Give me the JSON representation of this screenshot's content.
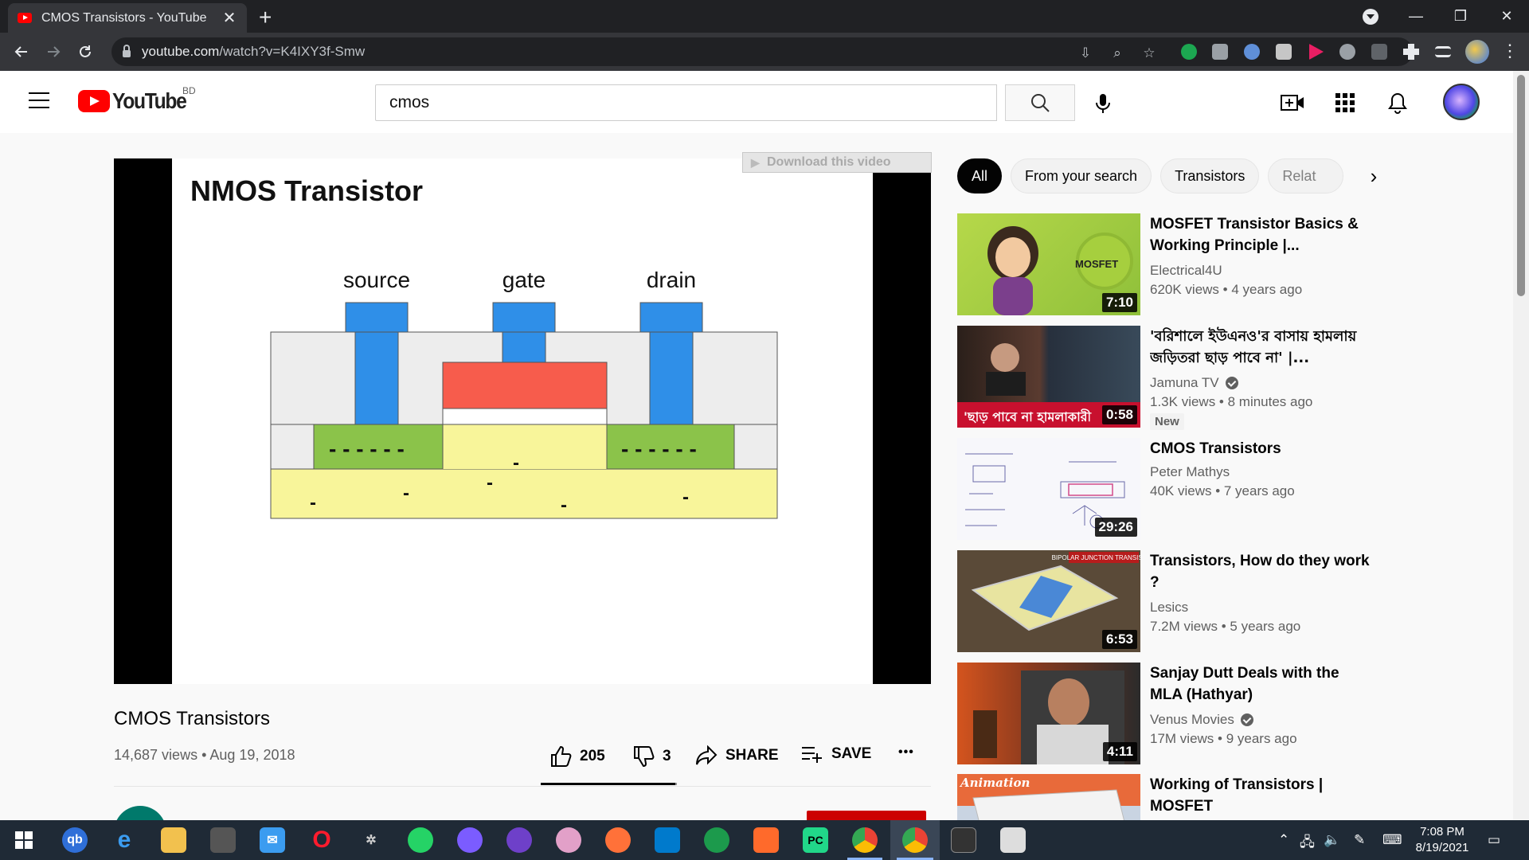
{
  "browser": {
    "tab_title": "CMOS Transistors - YouTube",
    "tab_close": "✕",
    "new_tab": "+",
    "url_host": "youtube.com",
    "url_path": "/watch?v=K4IXY3f-Smw",
    "window_controls": {
      "minimize": "—",
      "maximize": "❐",
      "close": "✕"
    }
  },
  "youtube_header": {
    "logo_text": "YouTube",
    "country_code": "BD",
    "search_value": "cmos"
  },
  "player": {
    "slide_title": "NMOS Transistor",
    "download_banner": "Download this video",
    "diagram_labels": {
      "source": "source",
      "gate": "gate",
      "drain": "drain"
    },
    "carrier_dashes_source": "- - - - - -",
    "carrier_dashes_drain": "- - - - - -",
    "free_carriers": [
      "-",
      "-",
      "-",
      "-",
      "-",
      "-"
    ]
  },
  "video": {
    "title": "CMOS Transistors",
    "views": "14,687 views",
    "date": "Aug 19, 2018",
    "meta_separator": " • ",
    "likes": "205",
    "dislikes": "3",
    "share_label": "SHARE",
    "save_label": "SAVE",
    "more": "•••",
    "like_ratio": 0.986
  },
  "chips": [
    "All",
    "From your search",
    "Transistors",
    "Relat"
  ],
  "recommendations": [
    {
      "title": "MOSFET Transistor Basics & Working Principle |...",
      "channel": "Electrical4U",
      "verified": false,
      "views": "620K views • 4 years ago",
      "duration": "7:10",
      "badge": "",
      "thumb_text": "MOSFET"
    },
    {
      "title": "'বরিশালে ইউএনও'র বাসায় হামলায় জড়িতরা ছাড় পাবে না' |...",
      "channel": "Jamuna TV",
      "verified": true,
      "views": "1.3K views • 8 minutes ago",
      "duration": "0:58",
      "badge": "New",
      "thumb_text": "'ছাড় পাবে না হামলাকারী"
    },
    {
      "title": "CMOS Transistors",
      "channel": "Peter Mathys",
      "verified": false,
      "views": "40K views • 7 years ago",
      "duration": "29:26",
      "badge": "",
      "thumb_text": ""
    },
    {
      "title": "Transistors, How do they work ?",
      "channel": "Lesics",
      "verified": false,
      "views": "7.2M views • 5 years ago",
      "duration": "6:53",
      "badge": "",
      "thumb_text": "BIPOLAR JUNCTION TRANSISTOR"
    },
    {
      "title": "Sanjay Dutt Deals with the MLA (Hathyar)",
      "channel": "Venus Movies",
      "verified": true,
      "views": "17M views • 9 years ago",
      "duration": "4:11",
      "badge": "",
      "thumb_text": ""
    },
    {
      "title": "Working of Transistors | MOSFET",
      "channel": "",
      "verified": false,
      "views": "",
      "duration": "",
      "badge": "",
      "thumb_text": "Animation"
    }
  ],
  "taskbar": {
    "time": "7:08 PM",
    "date": "8/19/2021"
  },
  "colors": {
    "youtube_red": "#ff0000",
    "metal_blue": "#2f8fe8",
    "gate_red": "#f75c4c",
    "ndoped_green": "#8bc34a",
    "substrate_yellow": "#f8f59a"
  }
}
